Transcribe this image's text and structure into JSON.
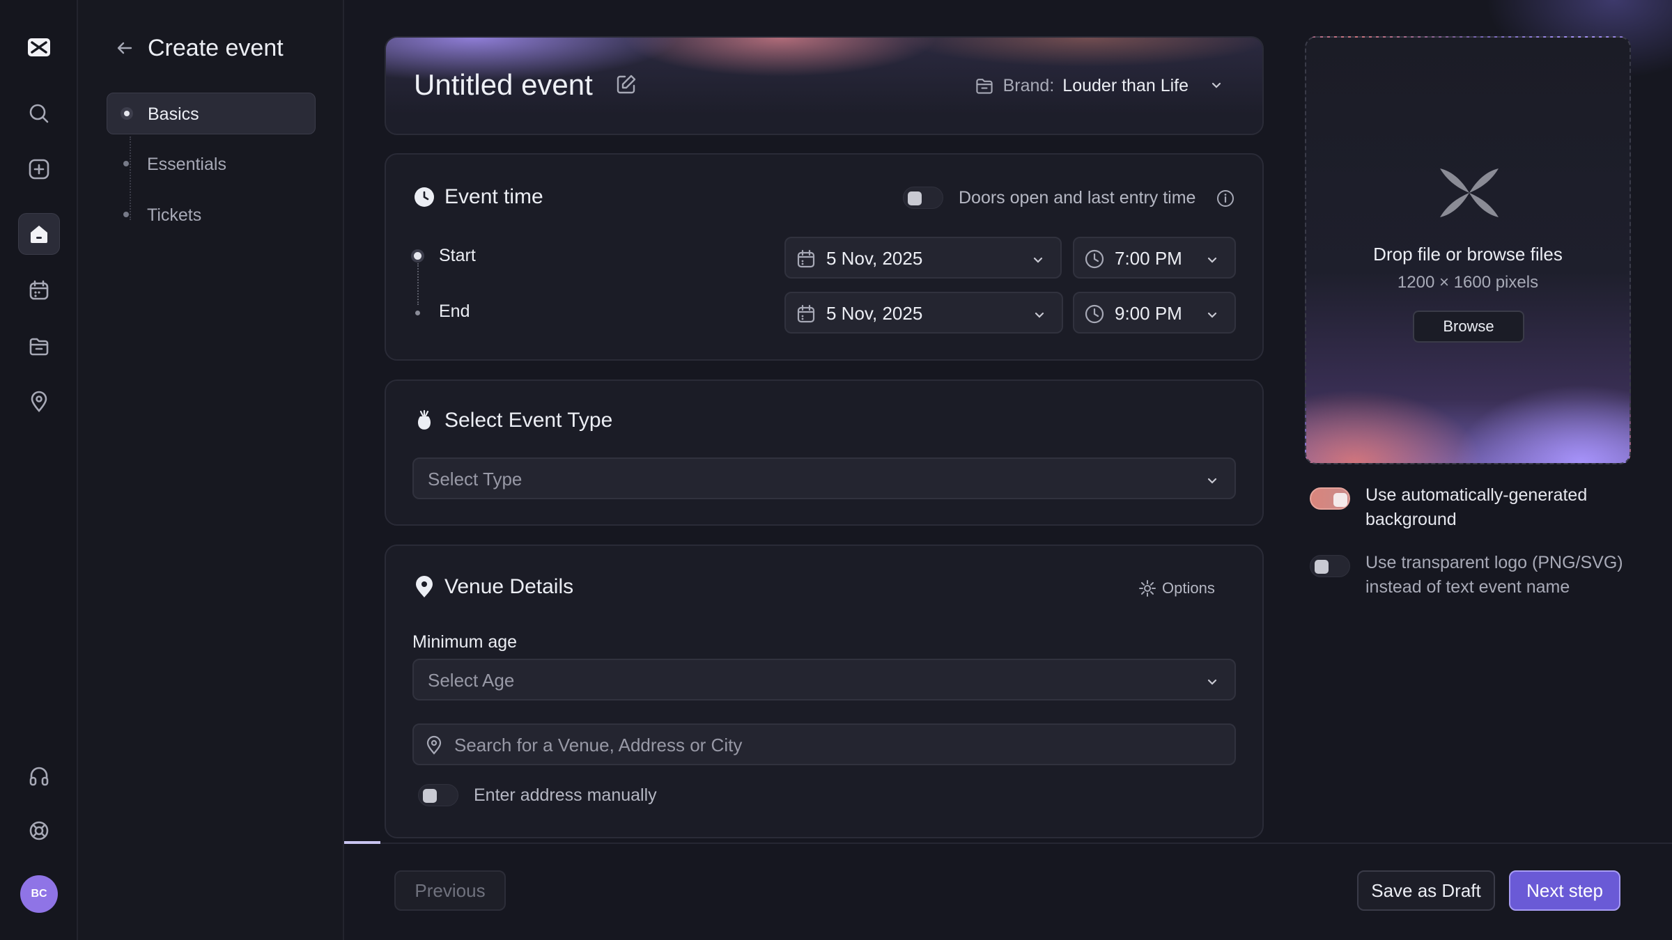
{
  "nav": {
    "items": [
      {
        "icon": "logo-icon"
      },
      {
        "icon": "search-icon"
      },
      {
        "icon": "add-icon"
      },
      {
        "icon": "home-icon",
        "active": true
      },
      {
        "icon": "calendar-icon"
      },
      {
        "icon": "folder-icon"
      },
      {
        "icon": "location-pin-icon"
      },
      {
        "icon": "headphones-icon"
      },
      {
        "icon": "lifebuoy-icon"
      }
    ],
    "avatar_initials": "BC"
  },
  "steps": {
    "title": "Create event",
    "items": [
      {
        "label": "Basics",
        "active": true
      },
      {
        "label": "Essentials"
      },
      {
        "label": "Tickets"
      }
    ]
  },
  "event": {
    "title": "Untitled event",
    "brand_prefix": "Brand:",
    "brand_value": "Louder than Life"
  },
  "event_time": {
    "heading": "Event time",
    "doors_toggle_label": "Doors open and last entry time",
    "doors_toggle_on": false,
    "start_label": "Start",
    "start_date": "5 Nov, 2025",
    "start_time": "7:00 PM",
    "end_label": "End",
    "end_date": "5 Nov, 2025",
    "end_time": "9:00 PM"
  },
  "event_type": {
    "heading": "Select Event Type",
    "placeholder": "Select Type"
  },
  "venue": {
    "heading": "Venue Details",
    "options_label": "Options",
    "min_age_label": "Minimum age",
    "min_age_placeholder": "Select Age",
    "search_placeholder": "Search for a Venue, Address or City",
    "manual_toggle_label": "Enter address manually",
    "manual_toggle_on": false
  },
  "upload": {
    "drop_text": "Drop file or browse files",
    "dimensions": "1200 × 1600 pixels",
    "browse_label": "Browse",
    "auto_bg_label": "Use automatically-generated background",
    "auto_bg_on": true,
    "transparent_logo_label": "Use transparent logo (PNG/SVG) instead of text event name",
    "transparent_logo_on": false
  },
  "footer": {
    "previous_label": "Previous",
    "save_draft_label": "Save as Draft",
    "next_label": "Next step"
  },
  "colors": {
    "accent": "#6a5ad6",
    "toggle_on": "#d9857c"
  }
}
